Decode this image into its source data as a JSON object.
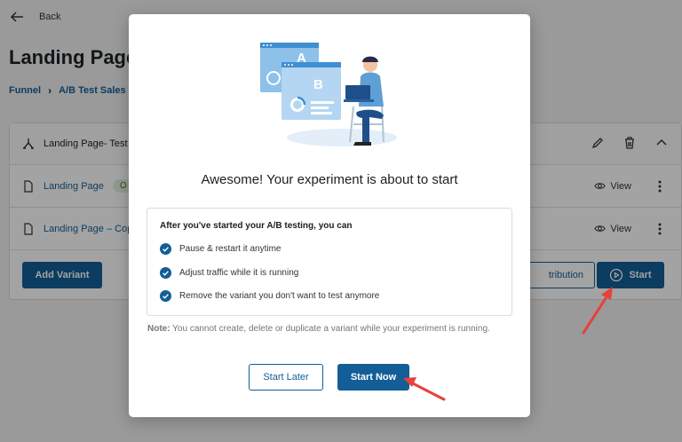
{
  "page": {
    "back_label": "Back",
    "title": "Landing Page",
    "breadcrumb": [
      "Funnel",
      "A/B Test Sales P"
    ]
  },
  "experiment": {
    "name": "Landing Page- Test",
    "variants": [
      {
        "name": "Landing Page",
        "badge": "O",
        "view_label": "View"
      },
      {
        "name": "Landing Page – Copy",
        "view_label": "View"
      }
    ],
    "add_variant_label": "Add Variant",
    "distribution_label": "tribution",
    "start_label": "Start"
  },
  "modal": {
    "title": "Awesome! Your experiment is about to start",
    "info_heading": "After you've started your A/B testing, you can",
    "checklist": [
      "Pause & restart it anytime",
      "Adjust traffic while it is running",
      "Remove the variant you don't want to test anymore"
    ],
    "note_label": "Note:",
    "note_text": " You cannot create, delete or duplicate a variant while your experiment is running.",
    "start_later_label": "Start Later",
    "start_now_label": "Start Now",
    "illustration_labels": [
      "A",
      "B"
    ]
  },
  "colors": {
    "primary": "#135e96",
    "annotation_arrow": "#e8413c",
    "check": "#135e96"
  }
}
